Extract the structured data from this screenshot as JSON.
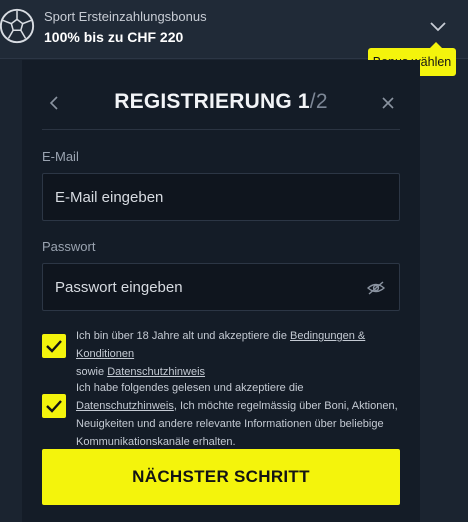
{
  "bonus": {
    "subtitle": "Sport Ersteinzahlungsbonus",
    "headline": "100% bis zu CHF 220",
    "tooltip": "Bonus wählen"
  },
  "modal": {
    "title_main": "REGISTRIERUNG 1",
    "title_total": "/2",
    "email": {
      "label": "E-Mail",
      "placeholder": "E-Mail eingeben",
      "value": ""
    },
    "password": {
      "label": "Passwort",
      "placeholder": "Passwort eingeben",
      "value": ""
    },
    "consent_terms": {
      "checked": true,
      "text_before": "Ich bin über 18 Jahre alt und akzeptiere die ",
      "link_terms": "Bedingungen & Konditionen",
      "text_middle": " sowie ",
      "link_privacy": "Datenschutzhinweis"
    },
    "consent_marketing": {
      "checked": true,
      "text_before": "Ich habe folgendes gelesen und akzeptiere die ",
      "link_privacy": "Datenschutzhinweis",
      "text_after": ", Ich möchte regelmässig über Boni, Aktionen, Neuigkeiten und andere relevante Informationen über beliebige Kommunikationskanäle erhalten."
    },
    "next_button": "NÄCHSTER SCHRITT"
  },
  "icons": {
    "ball": "soccer-ball-icon",
    "chevron": "chevron-down-icon",
    "back": "chevron-left-icon",
    "close": "close-icon",
    "eye": "eye-hidden-icon",
    "check": "checkmark-icon"
  },
  "colors": {
    "accent": "#f4f40c",
    "background": "#1b2430",
    "modal": "#141c27"
  }
}
